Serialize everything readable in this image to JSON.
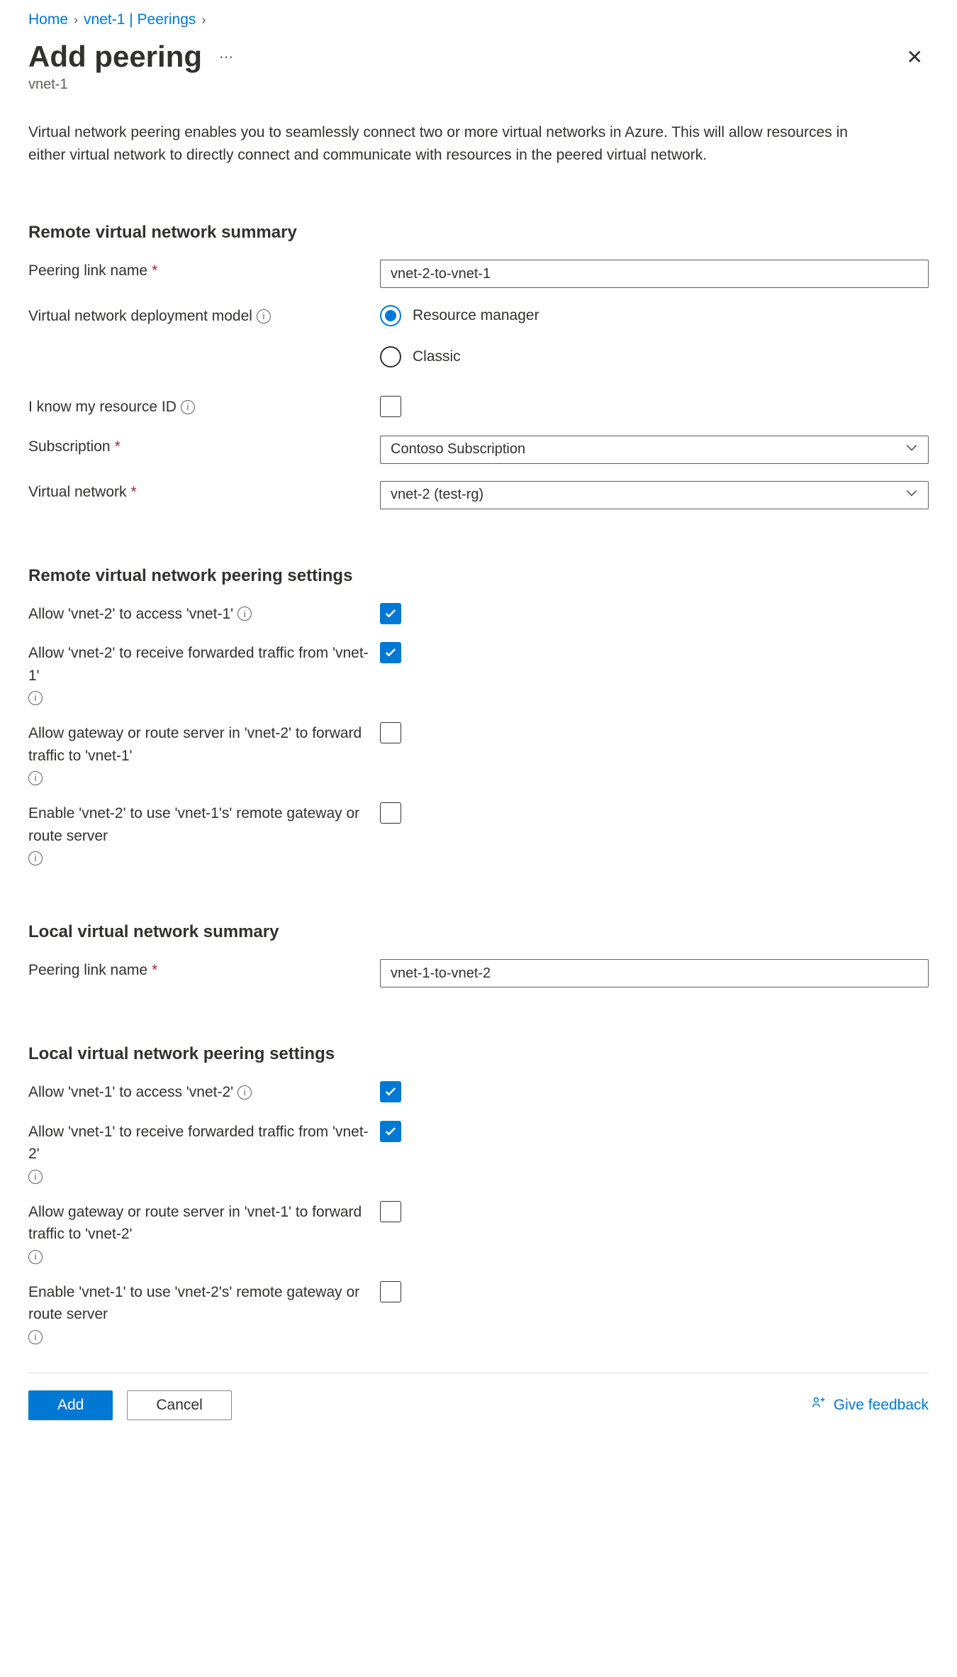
{
  "breadcrumb": {
    "home": "Home",
    "section": "vnet-1 | Peerings"
  },
  "header": {
    "title": "Add peering",
    "subtitle": "vnet-1"
  },
  "description": "Virtual network peering enables you to seamlessly connect two or more virtual networks in Azure. This will allow resources in either virtual network to directly connect and communicate with resources in the peered virtual network.",
  "sections": {
    "remote_summary": "Remote virtual network summary",
    "remote_settings": "Remote virtual network peering settings",
    "local_summary": "Local virtual network summary",
    "local_settings": "Local virtual network peering settings"
  },
  "remote": {
    "peering_link_label": "Peering link name",
    "peering_link_value": "vnet-2-to-vnet-1",
    "deploy_model_label": "Virtual network deployment model",
    "deploy_model_rm": "Resource manager",
    "deploy_model_classic": "Classic",
    "know_resource_id_label": "I know my resource ID",
    "subscription_label": "Subscription",
    "subscription_value": "Contoso Subscription",
    "vnet_label": "Virtual network",
    "vnet_value": "vnet-2 (test-rg)"
  },
  "remote_settings": {
    "allow_access": "Allow 'vnet-2' to access 'vnet-1'",
    "allow_forwarded": "Allow 'vnet-2' to receive forwarded traffic from 'vnet-1'",
    "allow_gateway": "Allow gateway or route server in 'vnet-2' to forward traffic to 'vnet-1'",
    "enable_remote_gw": "Enable 'vnet-2' to use 'vnet-1's' remote gateway or route server"
  },
  "local": {
    "peering_link_label": "Peering link name",
    "peering_link_value": "vnet-1-to-vnet-2"
  },
  "local_settings": {
    "allow_access": "Allow 'vnet-1' to access 'vnet-2'",
    "allow_forwarded": "Allow 'vnet-1' to receive forwarded traffic from 'vnet-2'",
    "allow_gateway": "Allow gateway or route server in 'vnet-1' to forward traffic to 'vnet-2'",
    "enable_remote_gw": "Enable 'vnet-1' to use 'vnet-2's' remote gateway or route server"
  },
  "footer": {
    "add": "Add",
    "cancel": "Cancel",
    "feedback": "Give feedback"
  }
}
